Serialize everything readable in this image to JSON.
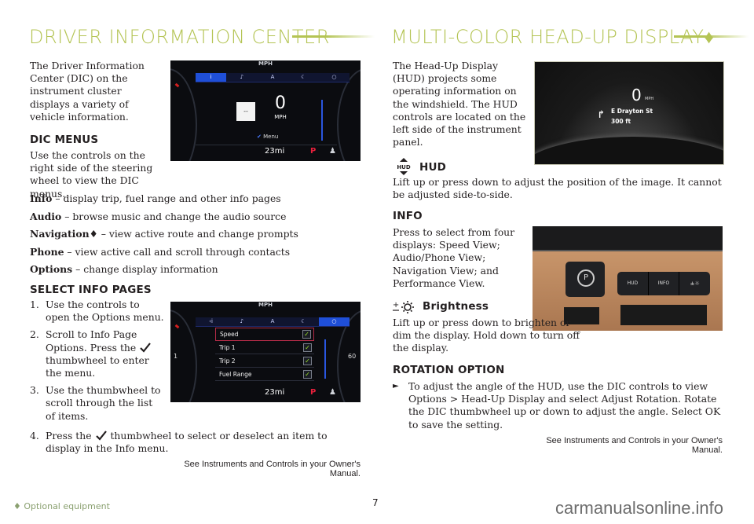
{
  "left_section": {
    "title": "DRIVER INFORMATION CENTER",
    "intro": "The Driver Information Center (DIC) on the instrument cluster displays a variety of vehicle information.",
    "dic_menus": {
      "heading": "DIC MENUS",
      "text": "Use the controls on the right side of the steering wheel to view the DIC menus.",
      "items": [
        {
          "label": "Info",
          "desc": " – display trip, fuel range and other info pages"
        },
        {
          "label": "Audio",
          "desc": " – browse music and change the audio source"
        },
        {
          "label": "Navigation♦",
          "desc": " – view active route and change prompts"
        },
        {
          "label": "Phone",
          "desc": " – view active call and scroll through contacts"
        },
        {
          "label": "Options",
          "desc": " – change display information"
        }
      ]
    },
    "select_info": {
      "heading": "SELECT INFO PAGES",
      "steps": [
        {
          "num": "1.",
          "text": "Use the controls to open the Options menu."
        },
        {
          "num": "2.",
          "text_before": "Scroll to Info Page Options. Press the",
          "text_after": "thumbwheel to enter the menu."
        },
        {
          "num": "3.",
          "text": "Use the thumbwheel to scroll through the list of items."
        },
        {
          "num": "4.",
          "text_before": "Press the",
          "text_after": "thumbwheel to select or deselect an item to display in the Info menu."
        }
      ]
    },
    "reference": "See Instruments and Controls in your Owner's Manual."
  },
  "cluster1": {
    "top_label": "MPH",
    "tabs": [
      "i",
      "♪",
      "A",
      "☾",
      "○"
    ],
    "active_tab": 0,
    "box_text": "--",
    "speed": "0",
    "speed_unit": "MPH",
    "menu_label": "Menu",
    "range": "23mi",
    "gear": "P"
  },
  "cluster2": {
    "top_label": "MPH",
    "tabs": [
      "‹i",
      "♪",
      "A",
      "☾",
      "○"
    ],
    "active_tab": 4,
    "options": [
      {
        "label": "Speed",
        "checked": true,
        "selected": true
      },
      {
        "label": "Trip 1",
        "checked": true,
        "selected": false
      },
      {
        "label": "Trip 2",
        "checked": true,
        "selected": false
      },
      {
        "label": "Fuel Range",
        "checked": true,
        "selected": false
      }
    ],
    "range": "23mi",
    "gear": "P",
    "gauge_left": "1",
    "gauge_right": "60"
  },
  "right_section": {
    "title": "MULTI-COLOR HEAD-UP DISPLAY♦",
    "intro": "The Head-Up Display (HUD) projects some operating information on the windshield. The HUD controls are located on the left side of the instrument panel.",
    "hud": {
      "icon_label": "HUD",
      "heading": "HUD",
      "text": "Lift up or press down to adjust the position of the image. It cannot be adjusted side-to-side."
    },
    "info": {
      "heading": "INFO",
      "text": "Press to select from four displays: Speed View; Audio/Phone View; Navigation View; and Performance View."
    },
    "brightness": {
      "heading": "Brightness",
      "text": "Lift up or press down to brighten or dim the display. Hold down to turn off the display."
    },
    "rotation": {
      "heading": "ROTATION OPTION",
      "text": "To adjust the angle of the HUD, use the DIC controls to view Options > Head-Up Display and select Adjust Rotation. Rotate the DIC thumbwheel up or down to adjust the angle. Select OK to save the setting."
    },
    "reference": "See Instruments and Controls in your Owner's Manual."
  },
  "hud_photo": {
    "speed": "0",
    "unit": "MPH",
    "street": "E Drayton St",
    "distance": "300 ft"
  },
  "dash_photo": {
    "buttons": [
      "HUD",
      "INFO",
      "±☼"
    ]
  },
  "footer": {
    "note": "♦ Optional equipment",
    "page": "7",
    "watermark": "carmanualsonline.info"
  },
  "colors": {
    "accent": "#b4c454",
    "active_tab": "#1f4fd8",
    "gear": "#e8203c",
    "check": "#9be22b"
  }
}
